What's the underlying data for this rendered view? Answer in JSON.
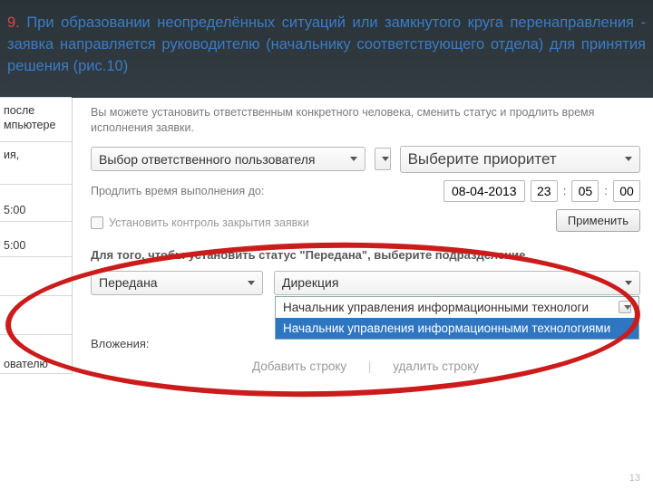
{
  "header": {
    "num": "9.",
    "text": "При образовании неопределённых ситуаций или замкнутого круга перенаправления - заявка направляется руководителю (начальнику соответствующего отдела) для принятия решения (рис.10)"
  },
  "left": {
    "r1": "после\nмпьютере",
    "r2": "ия,",
    "r3": "5:00",
    "r4": "5:00",
    "r5": "ователю"
  },
  "intro": "Вы можете установить ответственным конкретного человека, сменить статус и продлить время исполнения заявки.",
  "responsible": {
    "label": "Выбор ответственного пользователя"
  },
  "priority": {
    "label": "Выберите приоритет"
  },
  "extend": {
    "label": "Продлить время выполнения до:",
    "date": "08-04-2013",
    "hh": "23",
    "mm": "05",
    "ss": "00"
  },
  "control": {
    "label": "Установить контроль закрытия заявки"
  },
  "apply": {
    "label": "Применить"
  },
  "status_hint": "Для того, чтобы установить статус \"Передана\", выберите подразделение.",
  "status": {
    "value": "Передана"
  },
  "dept": {
    "value": "Дирекция",
    "opt1": "Начальник управления информационными технологи",
    "opt2": "Начальник управления информационными технологиями"
  },
  "attach": {
    "label": "Вложения:"
  },
  "links": {
    "add": "Добавить строку",
    "del": "удалить строку"
  },
  "page": "13"
}
